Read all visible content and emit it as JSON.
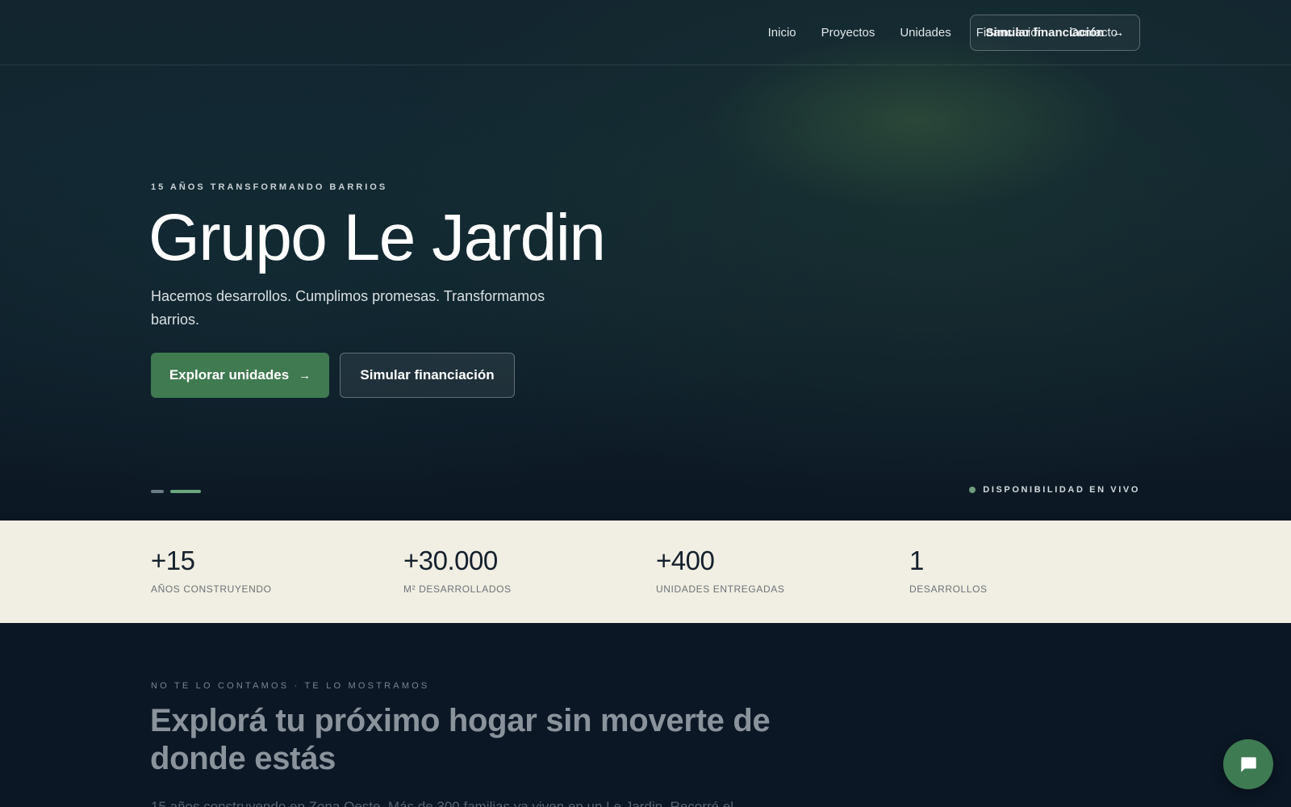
{
  "nav": {
    "links": [
      "Inicio",
      "Proyectos",
      "Unidades",
      "Financiación",
      "Contacto"
    ],
    "cta_label": "Simular financiación",
    "cta_icon": "arrow-right-icon"
  },
  "hero": {
    "eyebrow": "15 AÑOS TRANSFORMANDO BARRIOS",
    "title": "Grupo Le Jardin",
    "subtitle": "Hacemos desarrollos. Cumplimos promesas. Transformamos barrios.",
    "primary_button": "Explorar unidades",
    "secondary_button": "Simular financiación",
    "slider": {
      "slides": 2,
      "active_index": 1
    },
    "live_label": "DISPONIBILIDAD EN VIVO"
  },
  "stats": [
    {
      "value": "+15",
      "label": "AÑOS CONSTRUYENDO"
    },
    {
      "value": "+30.000",
      "label": "M² DESARROLLADOS"
    },
    {
      "value": "+400",
      "label": "UNIDADES ENTREGADAS"
    },
    {
      "value": "1",
      "label": "DESARROLLOS"
    }
  ],
  "section": {
    "eyebrow": "NO TE LO CONTAMOS · TE LO MOSTRAMOS",
    "title": "Explorá tu próximo hogar sin moverte de donde estás",
    "body": "15 años construyendo en Zona Oeste. Más de 300 familias ya viven en un Le Jardin. Recorré el"
  },
  "chat": {
    "icon": "chat-bubble-icon"
  },
  "colors": {
    "accent_green": "#3f7a50",
    "hero_bg": "#112530",
    "stats_bg": "#f1eee3",
    "section_bg": "#0b1725"
  }
}
